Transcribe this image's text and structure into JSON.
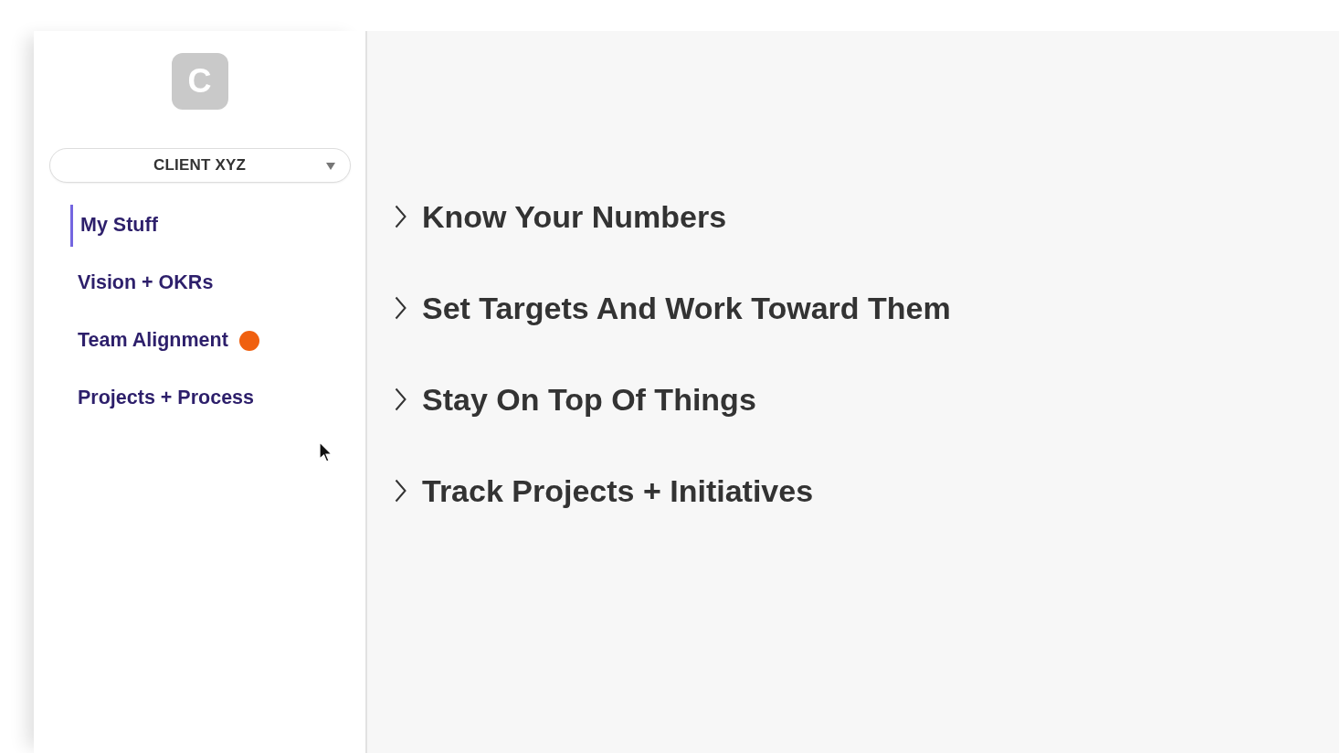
{
  "sidebar": {
    "logo": {
      "letter": "C"
    },
    "client_select": {
      "value": "CLIENT XYZ"
    },
    "nav_items": [
      {
        "label": "My Stuff",
        "selected": true
      },
      {
        "label": "Vision + OKRs",
        "selected": false
      },
      {
        "label": "Team Alignment",
        "selected": false,
        "color": "#f0600f"
      },
      {
        "label": "Projects + Process",
        "selected": false
      }
    ]
  },
  "sections": [
    {
      "title": "Know Your Numbers",
      "expanded": false
    },
    {
      "title": "Set Targets And Work Toward Them",
      "expanded": false
    },
    {
      "title": "Stay On Top Of Things",
      "expanded": false
    },
    {
      "title": "Track Projects + Initiatives",
      "expanded": false
    }
  ]
}
